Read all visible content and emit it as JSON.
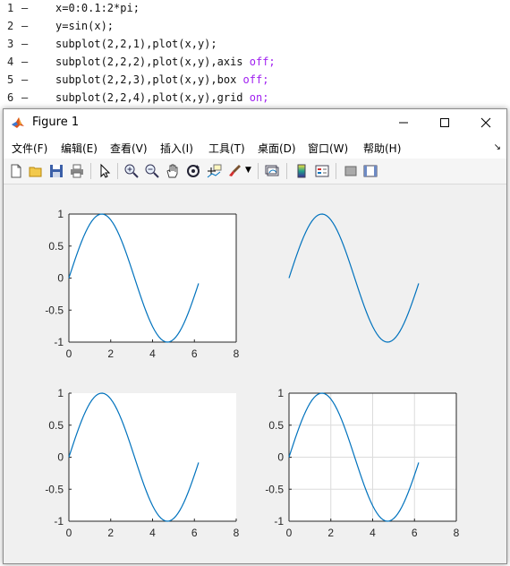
{
  "editor": {
    "lines": [
      {
        "num": "1",
        "dash": "–",
        "code": "x=0:0.1:2*pi;",
        "keyword": ""
      },
      {
        "num": "2",
        "dash": "–",
        "code": "y=sin(x);",
        "keyword": ""
      },
      {
        "num": "3",
        "dash": "–",
        "code": "subplot(2,2,1),plot(x,y);",
        "keyword": ""
      },
      {
        "num": "4",
        "dash": "–",
        "code": "subplot(2,2,2),plot(x,y),axis ",
        "keyword": "off;"
      },
      {
        "num": "5",
        "dash": "–",
        "code": "subplot(2,2,3),plot(x,y),box ",
        "keyword": "off;"
      },
      {
        "num": "6",
        "dash": "–",
        "code": "subplot(2,2,4),plot(x,y),grid ",
        "keyword": "on;"
      }
    ]
  },
  "figure": {
    "title": "Figure 1",
    "minimize_icon": "minimize-icon",
    "maximize_icon": "maximize-icon",
    "close_icon": "close-icon",
    "menu": [
      {
        "label": "文件(F)",
        "underline": "F"
      },
      {
        "label": "编辑(E)",
        "underline": "E"
      },
      {
        "label": "查看(V)",
        "underline": "V"
      },
      {
        "label": "插入(I)",
        "underline": "I"
      },
      {
        "label": "工具(T)",
        "underline": "T"
      },
      {
        "label": "桌面(D)",
        "underline": "D"
      },
      {
        "label": "窗口(W)",
        "underline": "W"
      },
      {
        "label": "帮助(H)",
        "underline": "H"
      }
    ],
    "menu_overflow": "↘",
    "toolbar": [
      "new-figure-icon",
      "open-icon",
      "save-icon",
      "print-icon",
      "pointer-icon",
      "zoom-in-icon",
      "zoom-out-icon",
      "pan-icon",
      "rotate-icon",
      "data-cursor-icon",
      "brush-icon",
      "brush-dropdown-icon",
      "link-plot-icon",
      "colorbar-icon",
      "legend-icon",
      "hide-plot-tools-icon",
      "show-plot-tools-icon"
    ]
  },
  "colors": {
    "line": "#0072bd",
    "axes_bg": "#ffffff",
    "figure_bg": "#f0f0f0",
    "grid": "#dcdcdc",
    "keyword": "#a020f0"
  },
  "chart_data": [
    {
      "type": "line",
      "subplot": "(2,2,1)",
      "title": "",
      "xlabel": "",
      "ylabel": "",
      "xlim": [
        0,
        8
      ],
      "ylim": [
        -1,
        1
      ],
      "xticks": [
        "0",
        "2",
        "4",
        "6",
        "8"
      ],
      "yticks": [
        "1",
        "0.5",
        "0",
        "-0.5",
        "-1"
      ],
      "axis": "on",
      "box": "on",
      "grid": "off",
      "series": [
        {
          "x_start": 0,
          "x_step": 0.1,
          "x_end": 6.2,
          "function": "sin(x)"
        }
      ]
    },
    {
      "type": "line",
      "subplot": "(2,2,2)",
      "title": "",
      "xlabel": "",
      "ylabel": "",
      "xlim": [
        0,
        8
      ],
      "ylim": [
        -1,
        1
      ],
      "xticks": [],
      "yticks": [],
      "axis": "off",
      "box": "off",
      "grid": "off",
      "series": [
        {
          "x_start": 0,
          "x_step": 0.1,
          "x_end": 6.2,
          "function": "sin(x)"
        }
      ]
    },
    {
      "type": "line",
      "subplot": "(2,2,3)",
      "title": "",
      "xlabel": "",
      "ylabel": "",
      "xlim": [
        0,
        8
      ],
      "ylim": [
        -1,
        1
      ],
      "xticks": [
        "0",
        "2",
        "4",
        "6",
        "8"
      ],
      "yticks": [
        "1",
        "0.5",
        "0",
        "-0.5",
        "-1"
      ],
      "axis": "on",
      "box": "off",
      "grid": "off",
      "series": [
        {
          "x_start": 0,
          "x_step": 0.1,
          "x_end": 6.2,
          "function": "sin(x)"
        }
      ]
    },
    {
      "type": "line",
      "subplot": "(2,2,4)",
      "title": "",
      "xlabel": "",
      "ylabel": "",
      "xlim": [
        0,
        8
      ],
      "ylim": [
        -1,
        1
      ],
      "xticks": [
        "0",
        "2",
        "4",
        "6",
        "8"
      ],
      "yticks": [
        "1",
        "0.5",
        "0",
        "-0.5",
        "-1"
      ],
      "axis": "on",
      "box": "on",
      "grid": "on",
      "series": [
        {
          "x_start": 0,
          "x_step": 0.1,
          "x_end": 6.2,
          "function": "sin(x)"
        }
      ]
    }
  ]
}
